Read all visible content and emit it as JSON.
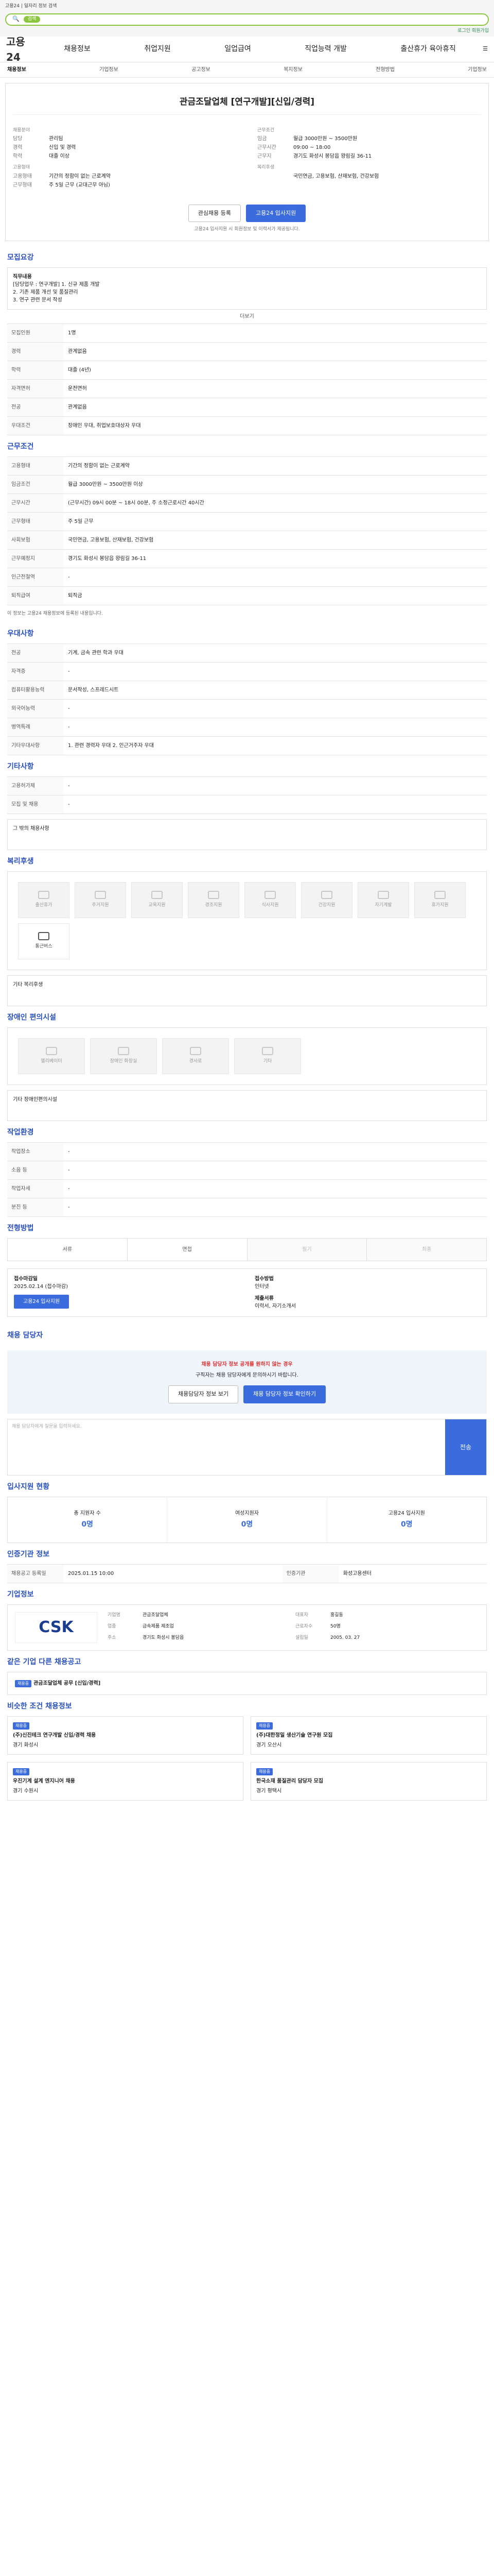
{
  "banner": {
    "top_text": "고용24 | 일자리 정보 검색",
    "search_pill": "검색",
    "right_link": "로그인 회원가입"
  },
  "header": {
    "logo": "고용24",
    "menu": [
      "채용정보",
      "취업지원",
      "일업급여",
      "직업능력 개발",
      "출산휴가 육아휴직"
    ]
  },
  "subnav": [
    "채용정보",
    "기업정보",
    "공고정보",
    "복지정보",
    "전형방법",
    "기업정보"
  ],
  "job": {
    "title": "관금조달업체 [연구개발][신입/경력]",
    "left_label": "채용분야",
    "left_rows": [
      {
        "k": "담당",
        "v": "관리팀"
      },
      {
        "k": "경력",
        "v": "신입 및 경력"
      },
      {
        "k": "학력",
        "v": "대졸 이상"
      }
    ],
    "left2_label": "고용형태",
    "left2_rows": [
      {
        "k": "고용형태",
        "v": "기간의 정함이 없는 근로계약"
      },
      {
        "k": "근무형태",
        "v": "주 5일 근무 (교대근무 아님)"
      }
    ],
    "right_label": "근무조건",
    "right_rows": [
      {
        "k": "임금",
        "v": "월급 3000만원 ~ 3500만원"
      },
      {
        "k": "근무시간",
        "v": "09:00 ~ 18:00"
      },
      {
        "k": "근무지",
        "v": "경기도 화성시 봉담읍 왕림길 36-11"
      }
    ],
    "right2_label": "복리후생",
    "right2_rows": [
      {
        "k": "",
        "v": "국민연금, 고용보험, 산재보험, 건강보험"
      }
    ],
    "btn_bookmark": "관심채용 등록",
    "btn_apply": "고용24 입사지원",
    "note": "고용24 입사지원 시 회원정보 및 이력서가 제공됩니다."
  },
  "recruit": {
    "title": "모집요강",
    "box_title": "직무내용",
    "box_lines": [
      "[담당업무 : 연구개발] 1. 신규 제품 개발",
      "2. 기존 제품 개선 및 품질관리",
      "3. 연구 관련 문서 작성"
    ],
    "more": "더보기",
    "rows": [
      {
        "k": "모집인원",
        "v": "1명"
      },
      {
        "k": "경력",
        "v": "관계없음"
      },
      {
        "k": "학력",
        "v": "대졸 (4년)"
      },
      {
        "k": "자격면허",
        "v": "운전면허"
      },
      {
        "k": "전공",
        "v": "관계없음"
      },
      {
        "k": "우대조건",
        "v": "장애인 우대, 취업보호대상자 우대"
      }
    ]
  },
  "conditions": {
    "title": "근무조건",
    "rows": [
      {
        "k": "고용형태",
        "v": "기간의 정함이 없는 근로계약"
      },
      {
        "k": "임금조건",
        "v": "월급 3000만원 ~ 3500만원 이상"
      },
      {
        "k": "근무시간",
        "v": "(근무시간) 09시 00분 ~ 18시 00분, 주 소정근로시간 40시간"
      },
      {
        "k": "근무형태",
        "v": "주 5일 근무"
      },
      {
        "k": "사회보험",
        "v": "국민연금, 고용보험, 산재보험, 건강보험"
      },
      {
        "k": "근무예정지",
        "v": "경기도 화성시 봉담읍 왕림길 36-11"
      },
      {
        "k": "인근전철역",
        "v": "-"
      },
      {
        "k": "퇴직급여",
        "v": "퇴직금"
      }
    ],
    "note": "이 정보는 고용24 채용정보에 등록된 내용입니다."
  },
  "qualifications": {
    "title": "우대사항",
    "rows": [
      {
        "k": "전공",
        "v": "기계, 금속 관련 학과 우대"
      },
      {
        "k": "자격증",
        "v": "-"
      },
      {
        "k": "컴퓨터활용능력",
        "v": "문서작성, 스프레드시트"
      },
      {
        "k": "외국어능력",
        "v": "-"
      },
      {
        "k": "병역특례",
        "v": "-"
      },
      {
        "k": "기타우대사항",
        "v": "1. 관련 경력자 우대  2. 인근거주자 우대"
      }
    ]
  },
  "etc": {
    "title": "기타사항",
    "rows": [
      {
        "k": "고용허가제",
        "v": "-"
      },
      {
        "k": "모집 및 채용",
        "v": "-"
      }
    ],
    "more_label": "그 밖의 채용사항"
  },
  "welfare": {
    "title": "복리후생",
    "items": [
      "출산휴가",
      "주거지원",
      "교육지원",
      "경조지원",
      "식사지원",
      "건강지원",
      "자기계발",
      "휴가지원",
      "통근버스",
      "기숙사"
    ],
    "other_label": "기타 복리후생"
  },
  "disability": {
    "title": "장애인 편의시설",
    "items": [
      "엘리베이터",
      "장애인 화장실",
      "경사로",
      "기타"
    ],
    "other_label": "기타 장애인편의시설"
  },
  "work_env": {
    "title": "작업환경",
    "rows": [
      {
        "k": "작업장소",
        "v": "-"
      },
      {
        "k": "소음 등",
        "v": "-"
      },
      {
        "k": "작업자세",
        "v": "-"
      },
      {
        "k": "분진 등",
        "v": "-"
      }
    ]
  },
  "process": {
    "title": "전형방법",
    "steps": [
      "서류",
      "면접",
      "필기",
      "최종"
    ]
  },
  "apply": {
    "deadline_label": "접수마감일",
    "deadline": "2025.02.14 (접수마감)",
    "method_label": "접수방법",
    "method": "인터넷",
    "apply_btn": "고용24 입사지원",
    "docs_label": "제출서류",
    "docs": "이력서, 자기소개서"
  },
  "contact": {
    "title": "채용 담당자",
    "warn": "채용 담당자 정보 공개를 원하지 않는 경우",
    "warn_sub": "구직자는 채용 담당자에게 문의하시기 바랍니다.",
    "btn1": "채용담당자 정보 보기",
    "btn2": "채용 담당자 정보 확인하기",
    "ta_placeholder": "채용 담당자에게 질문을 입력하세요.",
    "send": "전송"
  },
  "stats": {
    "title": "입사지원 현황",
    "items": [
      {
        "label": "총 지원자 수",
        "value": "0명"
      },
      {
        "label": "여성지원자",
        "value": "0명"
      },
      {
        "label": "고용24 입사지원",
        "value": "0명"
      }
    ]
  },
  "auth": {
    "title": "인증기관 정보",
    "rows": [
      {
        "k": "채용공고 등록일",
        "v": "2025.01.15 10:00"
      },
      {
        "k": "인증기관",
        "v": "화성고용센터"
      }
    ]
  },
  "company": {
    "title": "기업정보",
    "logo": "CSK",
    "rows": [
      {
        "k": "기업명",
        "v": "관금조달업체"
      },
      {
        "k": "대표자",
        "v": "홍길동"
      },
      {
        "k": "업종",
        "v": "금속제품 제조업"
      },
      {
        "k": "근로자수",
        "v": "50명"
      },
      {
        "k": "주소",
        "v": "경기도 화성시 봉담읍"
      },
      {
        "k": "설립일",
        "v": "2005. 03. 27"
      }
    ]
  },
  "same_company": {
    "title": "같은 기업 다른 채용공고",
    "tag": "채용중",
    "name": "관금조달업체 공무 [신입/경력]"
  },
  "similar": {
    "title": "비슷한 조건 채용정보",
    "jobs": [
      {
        "tag": "채용중",
        "name": "(주)신진테크 연구개발 신입/경력 채용",
        "loc": "경기 화성시"
      },
      {
        "tag": "채용중",
        "name": "(주)대한정밀 생산기술 연구원 모집",
        "loc": "경기 오산시"
      },
      {
        "tag": "채용중",
        "name": "우진기계 설계 엔지니어 채용",
        "loc": "경기 수원시"
      },
      {
        "tag": "채용중",
        "name": "한국소재 품질관리 담당자 모집",
        "loc": "경기 평택시"
      }
    ]
  }
}
